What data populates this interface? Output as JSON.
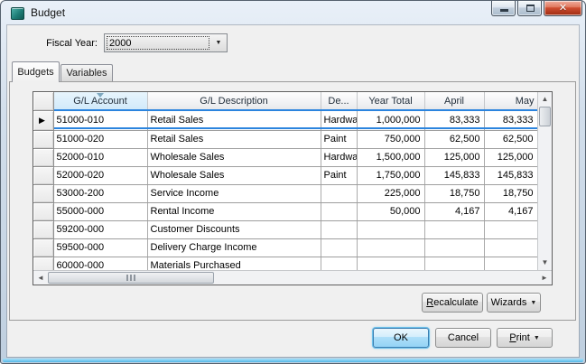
{
  "window": {
    "title": "Budget"
  },
  "icons": {
    "close": "✕",
    "dropdown": "▼",
    "scroll_up": "▲",
    "scroll_down": "▼",
    "scroll_left": "◄",
    "scroll_right": "►",
    "current_row": "▶"
  },
  "fiscal_year": {
    "label": "Fiscal Year:",
    "value": "2000"
  },
  "tabs": {
    "budgets": "Budgets",
    "variables": "Variables"
  },
  "grid": {
    "columns": [
      "",
      "G/L Account",
      "G/L Description",
      "De...",
      "Year Total",
      "April",
      "May"
    ],
    "rows": [
      {
        "current": true,
        "cells": [
          "51000-010",
          "Retail Sales",
          "Hardware",
          "1,000,000",
          "83,333",
          "83,333"
        ]
      },
      {
        "current": false,
        "cells": [
          "51000-020",
          "Retail Sales",
          "Paint",
          "750,000",
          "62,500",
          "62,500"
        ]
      },
      {
        "current": false,
        "cells": [
          "52000-010",
          "Wholesale Sales",
          "Hardware",
          "1,500,000",
          "125,000",
          "125,000"
        ]
      },
      {
        "current": false,
        "cells": [
          "52000-020",
          "Wholesale Sales",
          "Paint",
          "1,750,000",
          "145,833",
          "145,833"
        ]
      },
      {
        "current": false,
        "cells": [
          "53000-200",
          "Service Income",
          "",
          "225,000",
          "18,750",
          "18,750"
        ]
      },
      {
        "current": false,
        "cells": [
          "55000-000",
          "Rental Income",
          "",
          "50,000",
          "4,167",
          "4,167"
        ]
      },
      {
        "current": false,
        "cells": [
          "59200-000",
          "Customer Discounts",
          "",
          "",
          "",
          ""
        ]
      },
      {
        "current": false,
        "cells": [
          "59500-000",
          "Delivery Charge Income",
          "",
          "",
          "",
          ""
        ]
      },
      {
        "current": false,
        "cells": [
          "60000-000",
          "Materials Purchased",
          "",
          "",
          "",
          ""
        ]
      }
    ]
  },
  "buttons": {
    "recalculate_initial": "R",
    "recalculate_rest": "ecalculate",
    "wizards": "Wizards",
    "ok": "OK",
    "cancel": "Cancel",
    "print_initial": "P",
    "print_rest": "rint"
  }
}
